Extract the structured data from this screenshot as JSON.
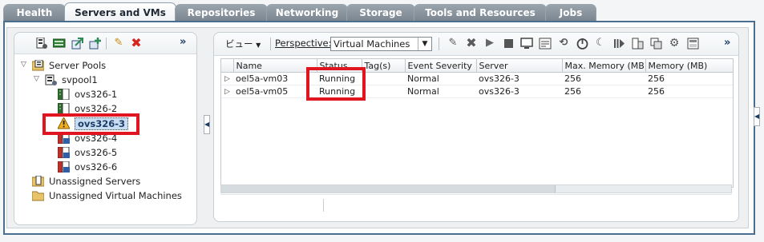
{
  "tabs": [
    {
      "label": "Health",
      "active": false
    },
    {
      "label": "Servers and VMs",
      "active": true
    },
    {
      "label": "Repositories",
      "active": false
    },
    {
      "label": "Networking",
      "active": false
    },
    {
      "label": "Storage",
      "active": false
    },
    {
      "label": "Tools and Resources",
      "active": false
    },
    {
      "label": "Jobs",
      "active": false
    }
  ],
  "left_panel": {
    "toolbar": {
      "icons": [
        "server-pool-icon",
        "discover-server-icon",
        "create-vm-icon",
        "import-icon",
        "edit-pencil-icon",
        "delete-x-icon"
      ],
      "more_label": "»"
    },
    "tree": {
      "root": {
        "label": "Server Pools",
        "expanded": true
      },
      "pool": {
        "label": "svpool1",
        "expanded": true
      },
      "servers": [
        {
          "label": "ovs326-1",
          "icon": "server-running-icon"
        },
        {
          "label": "ovs326-2",
          "icon": "server-running-icon"
        },
        {
          "label": "ovs326-3",
          "icon": "server-warning-icon",
          "selected": true
        },
        {
          "label": "ovs326-4",
          "icon": "server-stopped-icon"
        },
        {
          "label": "ovs326-5",
          "icon": "server-stopped-icon"
        },
        {
          "label": "ovs326-6",
          "icon": "server-stopped-icon"
        }
      ],
      "unassigned_servers": "Unassigned Servers",
      "unassigned_vms": "Unassigned Virtual Machines"
    }
  },
  "right_panel": {
    "toolbar": {
      "view_menu": "ビュー",
      "perspective_label": "Perspective:",
      "perspective_value": "Virtual Machines",
      "icons": [
        "edit-pencil-icon",
        "delete-x-icon",
        "start-icon",
        "stop-icon",
        "console-icon",
        "serial-console-icon",
        "restart-icon",
        "kill-icon",
        "suspend-icon",
        "resume-icon",
        "migrate-icon",
        "clone-icon",
        "settings-icon",
        "template-icon"
      ],
      "more_label": "»"
    },
    "table": {
      "columns": [
        "Name",
        "Status",
        "Tag(s)",
        "Event Severity",
        "Server",
        "Max. Memory (MB)",
        "Memory (MB)"
      ],
      "rows": [
        {
          "name": "oel5a-vm03",
          "status": "Running",
          "tags": "",
          "event_severity": "Normal",
          "server": "ovs326-3",
          "max_memory": "256",
          "memory": "256"
        },
        {
          "name": "oel5a-vm05",
          "status": "Running",
          "tags": "",
          "event_severity": "Normal",
          "server": "ovs326-3",
          "max_memory": "256",
          "memory": "256"
        }
      ]
    }
  },
  "collapse_arrow": "◀"
}
